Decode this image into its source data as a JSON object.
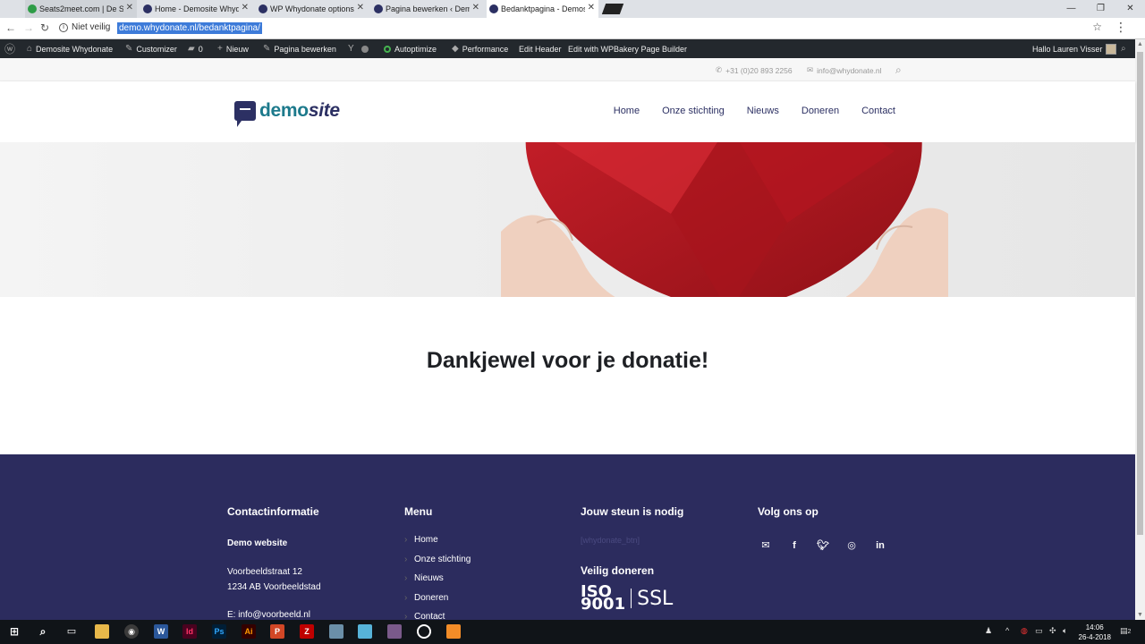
{
  "browser": {
    "tabs": [
      {
        "label": "Seats2meet.com | De Sti",
        "active": false
      },
      {
        "label": "Home - Demosite Whyd",
        "active": false
      },
      {
        "label": "WP Whydonate options",
        "active": false
      },
      {
        "label": "Pagina bewerken ‹ Demo",
        "active": false
      },
      {
        "label": "Bedanktpagina - Demosi",
        "active": true
      }
    ],
    "security_label": "Niet veilig",
    "url": "demo.whydonate.nl/bedanktpagina/"
  },
  "wp_admin_bar": {
    "site_name": "Demosite Whydonate",
    "customizer": "Customizer",
    "comments_count": "0",
    "new": "Nieuw",
    "edit_page": "Pagina bewerken",
    "autoptimize": "Autoptimize",
    "performance": "Performance",
    "edit_header": "Edit Header",
    "wpbakery": "Edit with WPBakery Page Builder",
    "greeting": "Hallo Lauren Visser"
  },
  "topbar": {
    "phone": "+31 (0)20 893 2256",
    "email": "info@whydonate.nl"
  },
  "logo": {
    "part1": "demo",
    "part2": "site"
  },
  "nav": {
    "items": [
      "Home",
      "Onze stichting",
      "Nieuws",
      "Doneren",
      "Contact"
    ]
  },
  "content": {
    "heading": "Dankjewel voor je donatie!"
  },
  "footer": {
    "contact": {
      "title": "Contactinformatie",
      "name": "Demo website",
      "street": "Voorbeeldstraat 12",
      "city": "1234 AB Voorbeeldstad",
      "email": "E: info@voorbeeld.nl"
    },
    "menu": {
      "title": "Menu",
      "items": [
        "Home",
        "Onze stichting",
        "Nieuws",
        "Doneren",
        "Contact"
      ]
    },
    "support": {
      "title": "Jouw steun is nodig",
      "shortcode": "[whydonate_btn]",
      "secure_title": "Veilig doneren",
      "iso_top": "ISO",
      "iso_bottom": "9001",
      "ssl": "SSL"
    },
    "follow": {
      "title": "Volg ons op",
      "icons": [
        "email-icon",
        "facebook-icon",
        "twitter-icon",
        "instagram-icon",
        "linkedin-icon"
      ]
    }
  },
  "taskbar": {
    "time": "14:06",
    "date": "26-4-2018",
    "notification_count": "2"
  }
}
